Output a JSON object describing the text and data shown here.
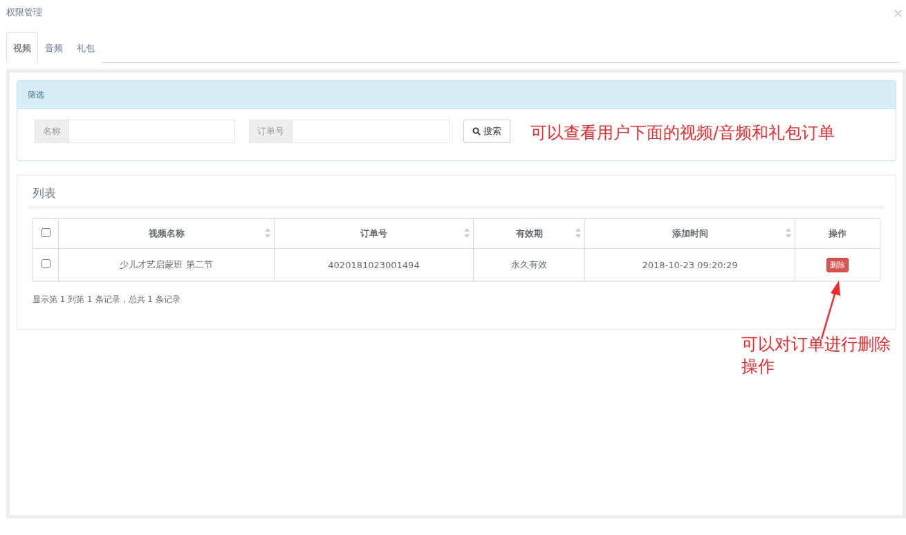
{
  "window": {
    "title": "权限管理",
    "close": "×"
  },
  "tabs": [
    {
      "label": "视频",
      "selected": true
    },
    {
      "label": "音频",
      "selected": false
    },
    {
      "label": "礼包",
      "selected": false
    }
  ],
  "filter": {
    "title": "筛选",
    "fields": [
      {
        "label": "名称"
      },
      {
        "label": "订单号"
      }
    ],
    "search_button": "搜索"
  },
  "list": {
    "title": "列表",
    "header_checkbox": {
      "checked": false
    },
    "columns": [
      {
        "label": "视频名称",
        "sortable": true
      },
      {
        "label": "订单号",
        "sortable": true
      },
      {
        "label": "有效期",
        "sortable": true
      },
      {
        "label": "添加时间",
        "sortable": true
      },
      {
        "label": "操作",
        "sortable": false
      }
    ],
    "rows": [
      {
        "checked": false,
        "cells": [
          "少儿才艺启蒙班 第二节",
          "4020181023001494",
          "永久有效",
          "2018-10-23 09:20:29"
        ],
        "action": "删除"
      }
    ],
    "summary": "显示第 1 到第 1 条记录，总共 1 条记录"
  },
  "annotations": [
    {
      "kind": "note",
      "text": "可以查看用户下面的视频/音频和礼包订单"
    },
    {
      "kind": "arrow-note",
      "text": "可以对订单进行删除操作"
    }
  ]
}
